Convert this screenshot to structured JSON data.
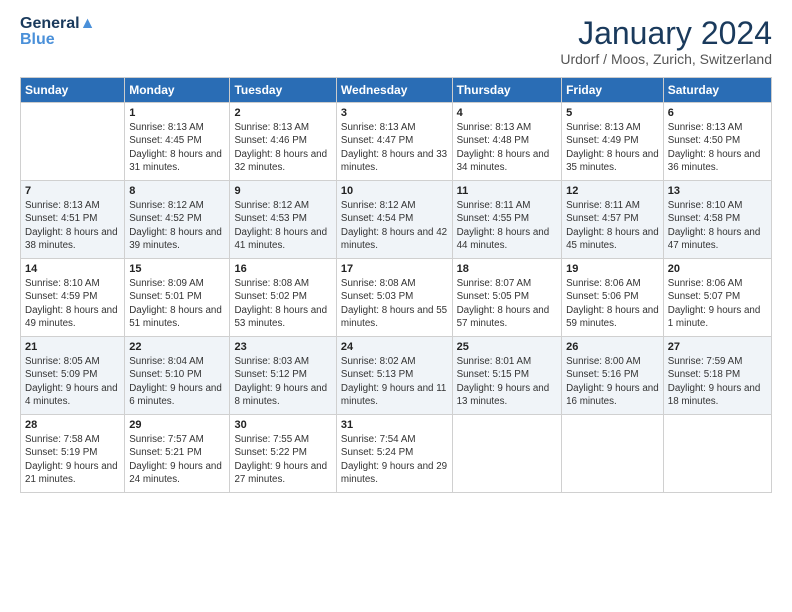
{
  "logo": {
    "line1": "General",
    "line2": "Blue"
  },
  "title": "January 2024",
  "subtitle": "Urdorf / Moos, Zurich, Switzerland",
  "days_of_week": [
    "Sunday",
    "Monday",
    "Tuesday",
    "Wednesday",
    "Thursday",
    "Friday",
    "Saturday"
  ],
  "weeks": [
    [
      {
        "day": "",
        "sunrise": "",
        "sunset": "",
        "daylight": ""
      },
      {
        "day": "1",
        "sunrise": "Sunrise: 8:13 AM",
        "sunset": "Sunset: 4:45 PM",
        "daylight": "Daylight: 8 hours and 31 minutes."
      },
      {
        "day": "2",
        "sunrise": "Sunrise: 8:13 AM",
        "sunset": "Sunset: 4:46 PM",
        "daylight": "Daylight: 8 hours and 32 minutes."
      },
      {
        "day": "3",
        "sunrise": "Sunrise: 8:13 AM",
        "sunset": "Sunset: 4:47 PM",
        "daylight": "Daylight: 8 hours and 33 minutes."
      },
      {
        "day": "4",
        "sunrise": "Sunrise: 8:13 AM",
        "sunset": "Sunset: 4:48 PM",
        "daylight": "Daylight: 8 hours and 34 minutes."
      },
      {
        "day": "5",
        "sunrise": "Sunrise: 8:13 AM",
        "sunset": "Sunset: 4:49 PM",
        "daylight": "Daylight: 8 hours and 35 minutes."
      },
      {
        "day": "6",
        "sunrise": "Sunrise: 8:13 AM",
        "sunset": "Sunset: 4:50 PM",
        "daylight": "Daylight: 8 hours and 36 minutes."
      }
    ],
    [
      {
        "day": "7",
        "sunrise": "Sunrise: 8:13 AM",
        "sunset": "Sunset: 4:51 PM",
        "daylight": "Daylight: 8 hours and 38 minutes."
      },
      {
        "day": "8",
        "sunrise": "Sunrise: 8:12 AM",
        "sunset": "Sunset: 4:52 PM",
        "daylight": "Daylight: 8 hours and 39 minutes."
      },
      {
        "day": "9",
        "sunrise": "Sunrise: 8:12 AM",
        "sunset": "Sunset: 4:53 PM",
        "daylight": "Daylight: 8 hours and 41 minutes."
      },
      {
        "day": "10",
        "sunrise": "Sunrise: 8:12 AM",
        "sunset": "Sunset: 4:54 PM",
        "daylight": "Daylight: 8 hours and 42 minutes."
      },
      {
        "day": "11",
        "sunrise": "Sunrise: 8:11 AM",
        "sunset": "Sunset: 4:55 PM",
        "daylight": "Daylight: 8 hours and 44 minutes."
      },
      {
        "day": "12",
        "sunrise": "Sunrise: 8:11 AM",
        "sunset": "Sunset: 4:57 PM",
        "daylight": "Daylight: 8 hours and 45 minutes."
      },
      {
        "day": "13",
        "sunrise": "Sunrise: 8:10 AM",
        "sunset": "Sunset: 4:58 PM",
        "daylight": "Daylight: 8 hours and 47 minutes."
      }
    ],
    [
      {
        "day": "14",
        "sunrise": "Sunrise: 8:10 AM",
        "sunset": "Sunset: 4:59 PM",
        "daylight": "Daylight: 8 hours and 49 minutes."
      },
      {
        "day": "15",
        "sunrise": "Sunrise: 8:09 AM",
        "sunset": "Sunset: 5:01 PM",
        "daylight": "Daylight: 8 hours and 51 minutes."
      },
      {
        "day": "16",
        "sunrise": "Sunrise: 8:08 AM",
        "sunset": "Sunset: 5:02 PM",
        "daylight": "Daylight: 8 hours and 53 minutes."
      },
      {
        "day": "17",
        "sunrise": "Sunrise: 8:08 AM",
        "sunset": "Sunset: 5:03 PM",
        "daylight": "Daylight: 8 hours and 55 minutes."
      },
      {
        "day": "18",
        "sunrise": "Sunrise: 8:07 AM",
        "sunset": "Sunset: 5:05 PM",
        "daylight": "Daylight: 8 hours and 57 minutes."
      },
      {
        "day": "19",
        "sunrise": "Sunrise: 8:06 AM",
        "sunset": "Sunset: 5:06 PM",
        "daylight": "Daylight: 8 hours and 59 minutes."
      },
      {
        "day": "20",
        "sunrise": "Sunrise: 8:06 AM",
        "sunset": "Sunset: 5:07 PM",
        "daylight": "Daylight: 9 hours and 1 minute."
      }
    ],
    [
      {
        "day": "21",
        "sunrise": "Sunrise: 8:05 AM",
        "sunset": "Sunset: 5:09 PM",
        "daylight": "Daylight: 9 hours and 4 minutes."
      },
      {
        "day": "22",
        "sunrise": "Sunrise: 8:04 AM",
        "sunset": "Sunset: 5:10 PM",
        "daylight": "Daylight: 9 hours and 6 minutes."
      },
      {
        "day": "23",
        "sunrise": "Sunrise: 8:03 AM",
        "sunset": "Sunset: 5:12 PM",
        "daylight": "Daylight: 9 hours and 8 minutes."
      },
      {
        "day": "24",
        "sunrise": "Sunrise: 8:02 AM",
        "sunset": "Sunset: 5:13 PM",
        "daylight": "Daylight: 9 hours and 11 minutes."
      },
      {
        "day": "25",
        "sunrise": "Sunrise: 8:01 AM",
        "sunset": "Sunset: 5:15 PM",
        "daylight": "Daylight: 9 hours and 13 minutes."
      },
      {
        "day": "26",
        "sunrise": "Sunrise: 8:00 AM",
        "sunset": "Sunset: 5:16 PM",
        "daylight": "Daylight: 9 hours and 16 minutes."
      },
      {
        "day": "27",
        "sunrise": "Sunrise: 7:59 AM",
        "sunset": "Sunset: 5:18 PM",
        "daylight": "Daylight: 9 hours and 18 minutes."
      }
    ],
    [
      {
        "day": "28",
        "sunrise": "Sunrise: 7:58 AM",
        "sunset": "Sunset: 5:19 PM",
        "daylight": "Daylight: 9 hours and 21 minutes."
      },
      {
        "day": "29",
        "sunrise": "Sunrise: 7:57 AM",
        "sunset": "Sunset: 5:21 PM",
        "daylight": "Daylight: 9 hours and 24 minutes."
      },
      {
        "day": "30",
        "sunrise": "Sunrise: 7:55 AM",
        "sunset": "Sunset: 5:22 PM",
        "daylight": "Daylight: 9 hours and 27 minutes."
      },
      {
        "day": "31",
        "sunrise": "Sunrise: 7:54 AM",
        "sunset": "Sunset: 5:24 PM",
        "daylight": "Daylight: 9 hours and 29 minutes."
      },
      {
        "day": "",
        "sunrise": "",
        "sunset": "",
        "daylight": ""
      },
      {
        "day": "",
        "sunrise": "",
        "sunset": "",
        "daylight": ""
      },
      {
        "day": "",
        "sunrise": "",
        "sunset": "",
        "daylight": ""
      }
    ]
  ]
}
